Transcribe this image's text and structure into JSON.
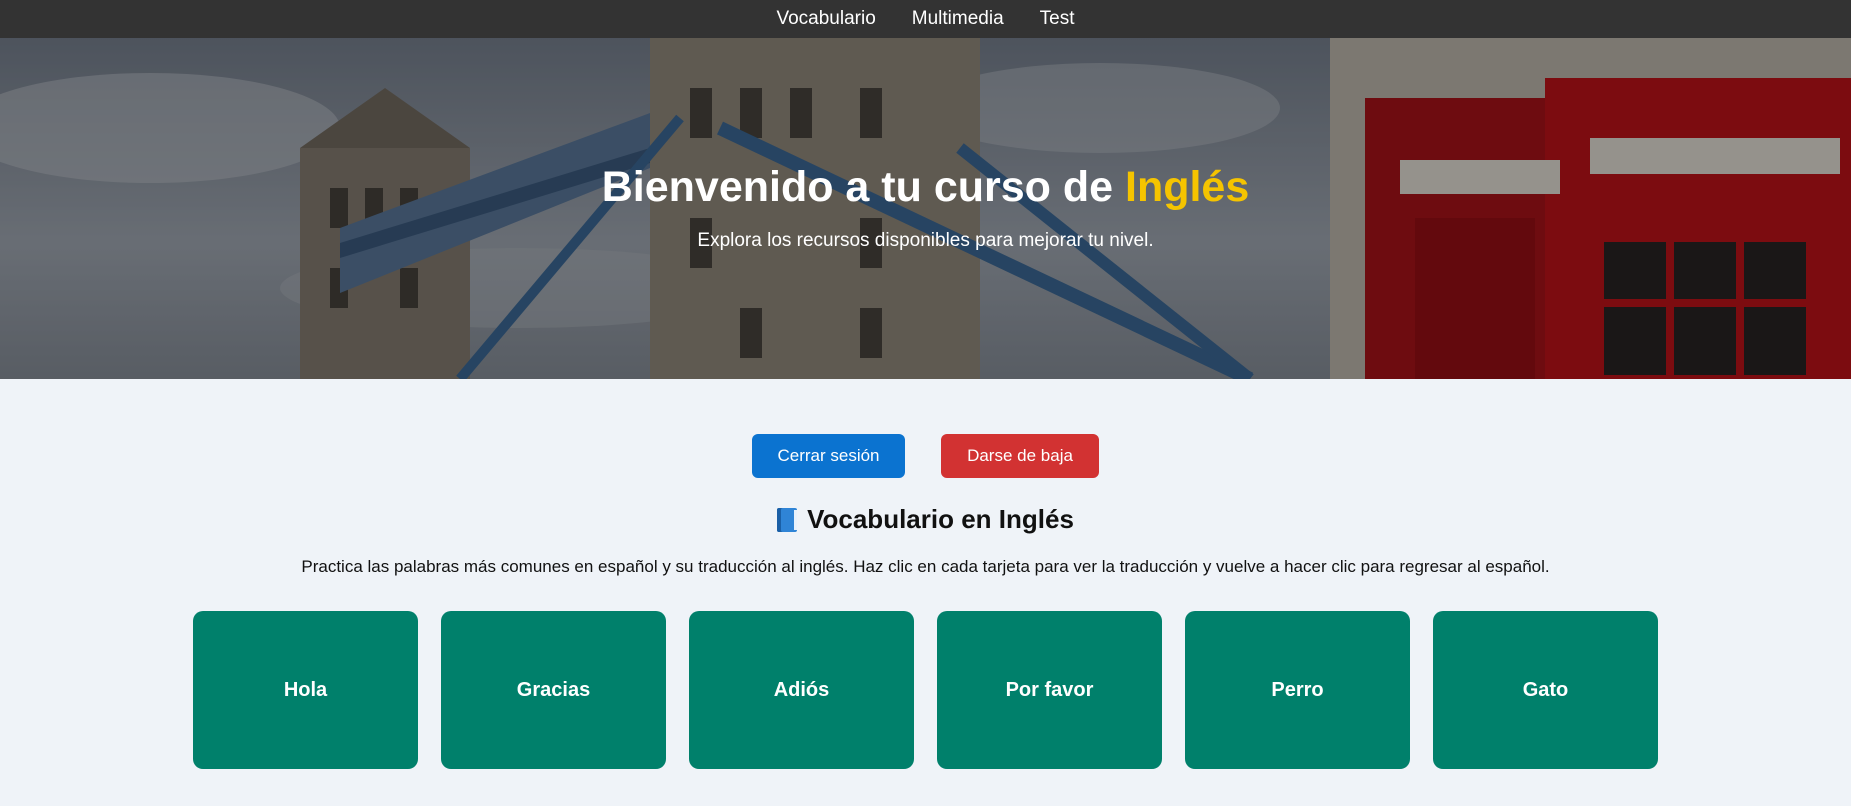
{
  "nav": {
    "items": [
      {
        "label": "Vocabulario"
      },
      {
        "label": "Multimedia"
      },
      {
        "label": "Test"
      }
    ]
  },
  "hero": {
    "title_prefix": "Bienvenido a tu curso de ",
    "title_accent": "Inglés",
    "subtitle": "Explora los recursos disponibles para mejorar tu nivel.",
    "accent_color": "#f5c400",
    "background_image": "london-tower-bridge-and-red-telephone-box"
  },
  "actions": {
    "logout_label": "Cerrar sesión",
    "unsubscribe_label": "Darse de baja",
    "logout_color": "#0b73d0",
    "unsubscribe_color": "#d23232"
  },
  "vocab": {
    "icon": "book-icon",
    "title": "Vocabulario en Inglés",
    "description": "Practica las palabras más comunes en español y su traducción al inglés. Haz clic en cada tarjeta para ver la traducción y vuelve a hacer clic para regresar al español.",
    "card_color": "#00806b",
    "cards": [
      {
        "word": "Hola"
      },
      {
        "word": "Gracias"
      },
      {
        "word": "Adiós"
      },
      {
        "word": "Por favor"
      },
      {
        "word": "Perro"
      },
      {
        "word": "Gato"
      }
    ]
  }
}
